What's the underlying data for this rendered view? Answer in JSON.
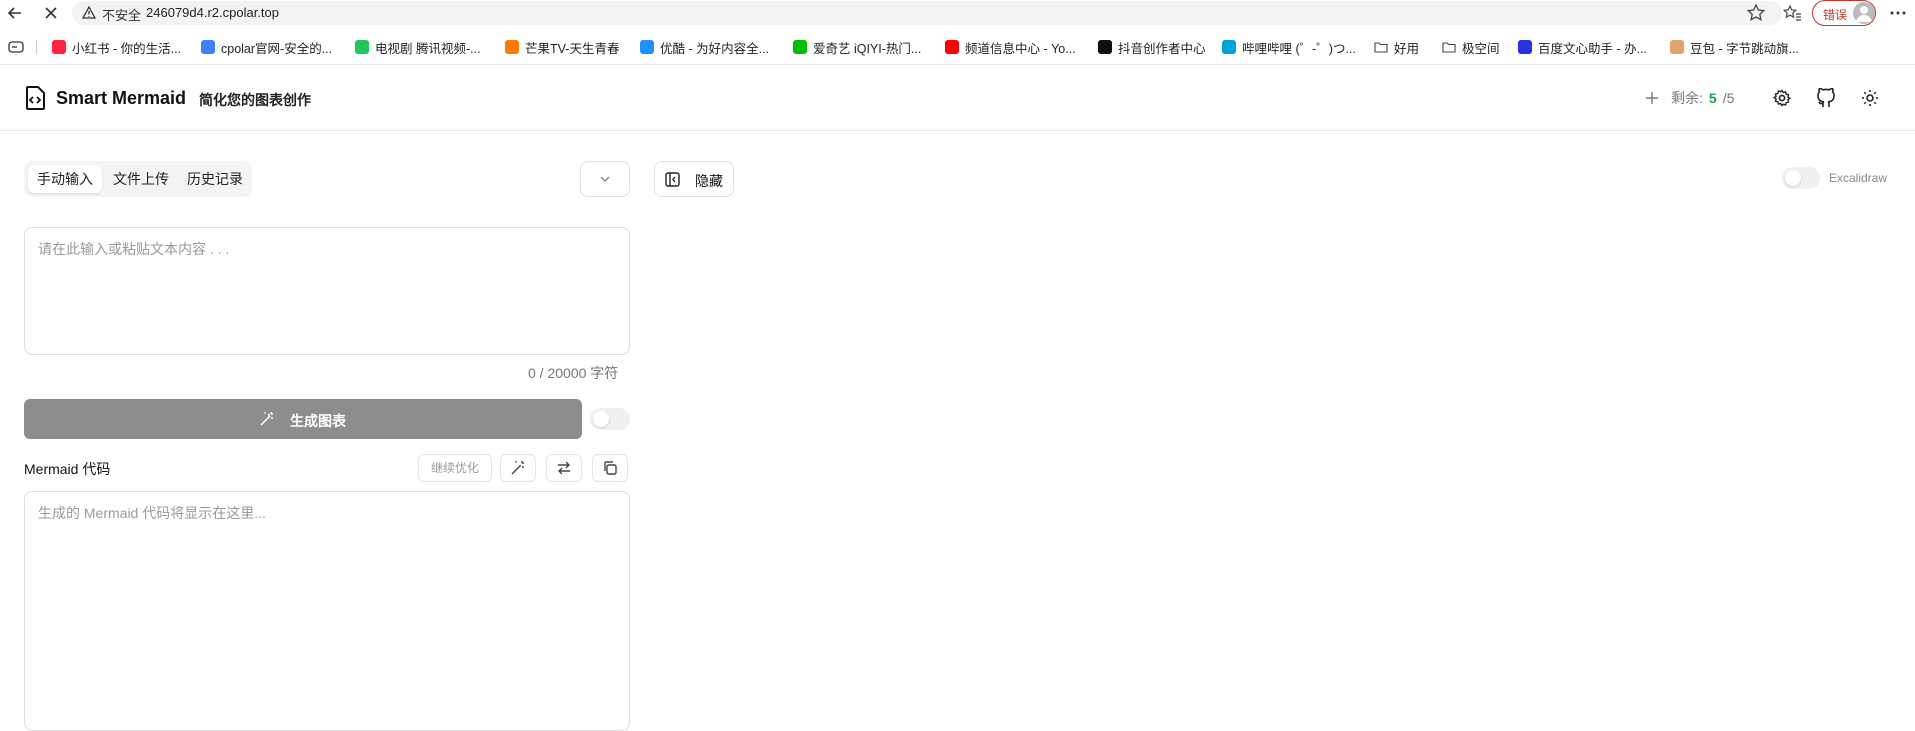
{
  "browser": {
    "security_label": "不安全",
    "url": "246079d4.r2.cpolar.top",
    "profile_error_label": "错误",
    "bookmarks": [
      {
        "label": "小红书 - 你的生活...",
        "color": "#ff2442"
      },
      {
        "label": "cpolar官网-安全的...",
        "color": "#3b82f6"
      },
      {
        "label": "电视剧 腾讯视频-...",
        "color": "#22c55e"
      },
      {
        "label": "芒果TV-天生青春",
        "color": "#ff7a00"
      },
      {
        "label": "优酷 - 为好内容全...",
        "color": "#1e90ff"
      },
      {
        "label": "爱奇艺 iQIYI-热门...",
        "color": "#00be06"
      },
      {
        "label": "频道信息中心 - Yo...",
        "color": "#ff0000"
      },
      {
        "label": "抖音创作者中心",
        "color": "#111111"
      },
      {
        "label": "哔哩哔哩 (゜-゜)つ...",
        "color": "#00a1d6"
      },
      {
        "label": "好用",
        "color": "folder"
      },
      {
        "label": "极空间",
        "color": "folder"
      },
      {
        "label": "百度文心助手 - 办...",
        "color": "#2932e1"
      },
      {
        "label": "豆包 - 字节跳动旗...",
        "color": "#e0a36d"
      }
    ]
  },
  "header": {
    "title": "Smart Mermaid",
    "subtitle": "简化您的图表创作",
    "quota_label": "剩余:",
    "quota_remaining": "5",
    "quota_total": "/5"
  },
  "input_panel": {
    "tabs": [
      "手动输入",
      "文件上传",
      "历史记录"
    ],
    "active_tab": "手动输入",
    "text_placeholder": "请在此输入或粘贴文本内容 . . .",
    "char_count": "0 / 20000 字符",
    "generate_label": "生成图表",
    "code_label": "Mermaid 代码",
    "optimize_label": "继续优化",
    "code_placeholder": "生成的 Mermaid 代码将显示在这里..."
  },
  "preview_panel": {
    "hide_label": "隐藏",
    "excalidraw_label": "Excalidraw"
  },
  "colors": {
    "accent_green": "#16a34a",
    "generate_button_disabled": "#8d8d8d",
    "error_red": "#c0392b"
  }
}
